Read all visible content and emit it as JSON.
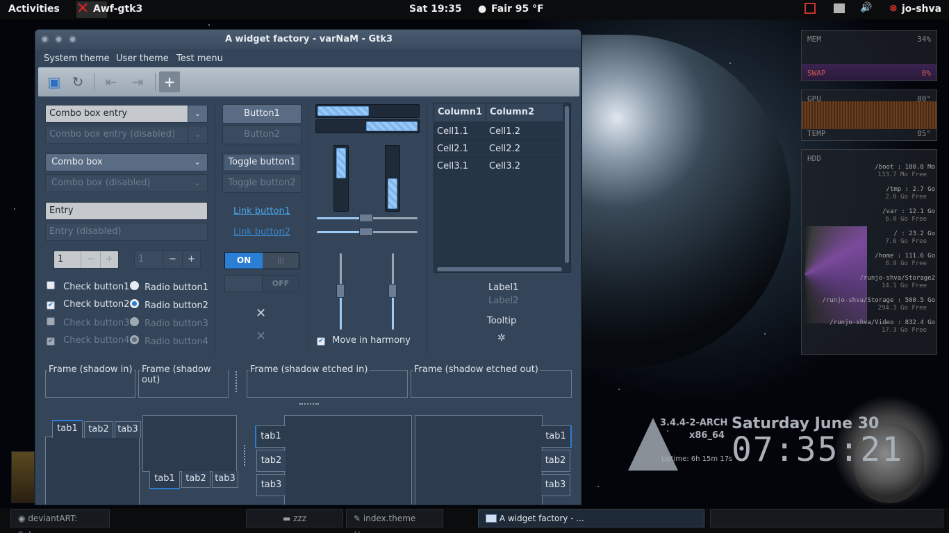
{
  "topbar": {
    "activities": "Activities",
    "app_name": "Awf-gtk3",
    "datetime": "Sat 19:35",
    "weather": "Fair 95 °F",
    "user": "jo-shva"
  },
  "conky": {
    "mem_label": "MEM",
    "mem_value": "34%",
    "swap_label": "SWAP",
    "swap_value": "0%",
    "gpu_label": "GPU",
    "gpu_value": "80°",
    "temp_label": "TEMP",
    "temp_value": "85°",
    "hdd_label": "HDD",
    "hdd_entries": [
      {
        "path": "/boot : 180.8 Mo",
        "free": "133.7 Mo Free"
      },
      {
        "path": "/tmp : 2.7 Go",
        "free": "2.0 Go Free"
      },
      {
        "path": "/var : 12.1 Go",
        "free": "6.0 Go Free"
      },
      {
        "path": "/ : 23.2 Go",
        "free": "7.6 Go Free"
      },
      {
        "path": "/home : 111.6 Go",
        "free": "8.9 Go Free"
      },
      {
        "path": "/runjo-shva/Storage2",
        "free": "14.1 Go Free"
      },
      {
        "path": "/runjo-shva/Storage : 500.5 Go",
        "free": "294.3 Go Free"
      },
      {
        "path": "/runjo-shva/Video : 832.4 Go",
        "free": "17.3 Go Free"
      }
    ]
  },
  "clock": {
    "kernel": "3.4.4-2-ARCH",
    "arch": "x86_64",
    "uptime": "Uptime: 6h 15m 17s",
    "date": "Saturday June 30",
    "time": "07:35:21"
  },
  "window": {
    "title": "A widget factory - varNaM - Gtk3",
    "menu": [
      "System theme",
      "User theme",
      "Test menu"
    ],
    "combo_entry": "Combo box entry",
    "combo_entry_disabled": "Combo box entry (disabled)",
    "combo_box": "Combo box",
    "combo_box_disabled": "Combo box (disabled)",
    "entry": "Entry",
    "entry_disabled": "Entry (disabled)",
    "spin_value": "1",
    "spin_value_disabled": "1",
    "checks": [
      "Check button1",
      "Check button2",
      "Check button3",
      "Check button4"
    ],
    "radios": [
      "Radio button1",
      "Radio button2",
      "Radio button3",
      "Radio button4"
    ],
    "button1": "Button1",
    "button2": "Button2",
    "toggle1": "Toggle button1",
    "toggle2": "Toggle button2",
    "link1": "Link button1",
    "link2": "Link button2",
    "switch_on": "ON",
    "switch_off": "OFF",
    "move_in_harmony": "Move in harmony",
    "tree": {
      "columns": [
        "Column1",
        "Column2"
      ],
      "rows": [
        [
          "Cell1.1",
          "Cell1.2"
        ],
        [
          "Cell2.1",
          "Cell2.2"
        ],
        [
          "Cell3.1",
          "Cell3.2"
        ]
      ]
    },
    "label1": "Label1",
    "label2": "Label2",
    "tooltip": "Tooltip",
    "frames": [
      "Frame (shadow in)",
      "Frame (shadow out)",
      "Frame (shadow etched in)",
      "Frame (shadow etched out)"
    ],
    "tabs": [
      "tab1",
      "tab2",
      "tab3"
    ]
  },
  "taskbar": {
    "items": [
      "deviantART: Subm...",
      "zzz",
      "index.theme (/usr...",
      "A widget factory - ..."
    ]
  }
}
